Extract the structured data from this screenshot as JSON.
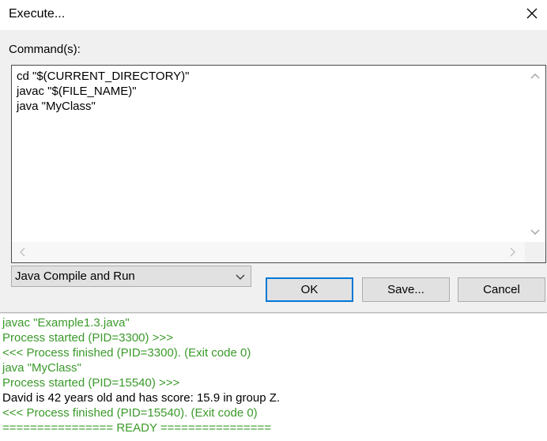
{
  "dialog": {
    "title": "Execute...",
    "command_label": "Command(s):",
    "commands": "cd \"$(CURRENT_DIRECTORY)\"\njavac \"$(FILE_NAME)\"\njava \"MyClass\"",
    "preset_selected": "Java Compile and Run",
    "ok_label": "OK",
    "save_label": "Save...",
    "cancel_label": "Cancel"
  },
  "console": {
    "lines": [
      "javac \"Example1.3.java\"",
      "Process started (PID=3300) >>>",
      "<<< Process finished (PID=3300). (Exit code 0)",
      "java \"MyClass\"",
      "Process started (PID=15540) >>>",
      "David is 42 years old and has score: 15.9 in group Z.",
      "<<< Process finished (PID=15540). (Exit code 0)",
      "================ READY ================"
    ]
  },
  "colors": {
    "console_status": "#3a9a2a",
    "accent_focus": "#0078d7"
  },
  "icons": [
    "close-icon",
    "scroll-up-icon",
    "scroll-down-icon",
    "scroll-left-icon",
    "scroll-right-icon",
    "chevron-down-icon"
  ]
}
